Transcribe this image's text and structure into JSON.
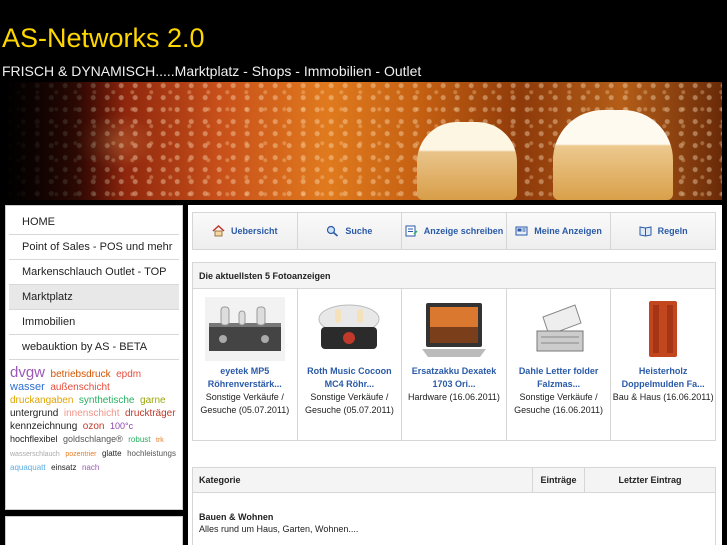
{
  "header": {
    "title": "AS-Networks 2.0",
    "subtitle": "FRISCH & DYNAMISCH.....Marktplatz - Shops - Immobilien - Outlet"
  },
  "sidebar": {
    "items": [
      {
        "label": "HOME"
      },
      {
        "label": "Point of Sales - POS und mehr"
      },
      {
        "label": "Markenschlauch Outlet - TOP"
      },
      {
        "label": "Marktplatz"
      },
      {
        "label": "Immobilien"
      },
      {
        "label": "webauktion by AS - BETA"
      }
    ],
    "tags": [
      {
        "text": "dvgw",
        "color": "#9b59b6",
        "size": "15px"
      },
      {
        "text": "betriebsdruck",
        "color": "#d35400",
        "size": "10px"
      },
      {
        "text": "epdm",
        "color": "#e74c3c",
        "size": "10px"
      },
      {
        "text": "wasser",
        "color": "#2e6fd1",
        "size": "11px"
      },
      {
        "text": "außenschicht",
        "color": "#e74c3c",
        "size": "10px"
      },
      {
        "text": "druckangaben",
        "color": "#e0a400",
        "size": "10px"
      },
      {
        "text": "synthetische",
        "color": "#27ae60",
        "size": "10px"
      },
      {
        "text": "garne",
        "color": "#9aa80c",
        "size": "10px"
      },
      {
        "text": "untergrund",
        "color": "#222222",
        "size": "10px"
      },
      {
        "text": "innenschicht",
        "color": "#f1948a",
        "size": "10px"
      },
      {
        "text": "druckträger",
        "color": "#c0392b",
        "size": "10px"
      },
      {
        "text": "kennzeichnung",
        "color": "#222222",
        "size": "10px"
      },
      {
        "text": "ozon",
        "color": "#c0392b",
        "size": "10px"
      },
      {
        "text": "100°c",
        "color": "#8e44ad",
        "size": "9px"
      },
      {
        "text": "hochflexibel",
        "color": "#222222",
        "size": "9px"
      },
      {
        "text": "goldschlange®",
        "color": "#555555",
        "size": "9px"
      },
      {
        "text": "robust",
        "color": "#27ae60",
        "size": "8px"
      },
      {
        "text": "trk",
        "color": "#e67e22",
        "size": "7px"
      },
      {
        "text": "wasserschlauch",
        "color": "#aaaaaa",
        "size": "7px"
      },
      {
        "text": "pozentrier",
        "color": "#e67e22",
        "size": "7px"
      },
      {
        "text": "glatte",
        "color": "#222222",
        "size": "8px"
      },
      {
        "text": "hochleistungs",
        "color": "#555555",
        "size": "8px"
      },
      {
        "text": "aquaquatt",
        "color": "#5dade2",
        "size": "8px"
      },
      {
        "text": "einsatz",
        "color": "#222222",
        "size": "8px"
      },
      {
        "text": "nach",
        "color": "#9b59b6",
        "size": "8px"
      }
    ]
  },
  "menu": [
    {
      "label": "Uebersicht",
      "icon": "home-icon"
    },
    {
      "label": "Suche",
      "icon": "search-icon"
    },
    {
      "label": "Anzeige schreiben",
      "icon": "write-ad-icon"
    },
    {
      "label": "Meine Anzeigen",
      "icon": "my-ads-icon"
    },
    {
      "label": "Regeln",
      "icon": "book-icon"
    }
  ],
  "photo_ads": {
    "title": "Die aktuellsten 5 Fotoanzeigen",
    "items": [
      {
        "title": "eyetek MP5 Röhrenverstärk...",
        "meta": "Sonstige Verkäufe / Gesuche (05.07.2011)"
      },
      {
        "title": "Roth Music Cocoon MC4 Röhr...",
        "meta": "Sonstige Verkäufe / Gesuche (05.07.2011)"
      },
      {
        "title": "Ersatzakku Dexatek 1703 Ori...",
        "meta": "Hardware (16.06.2011)"
      },
      {
        "title": "Dahle Letter folder Falzmas...",
        "meta": "Sonstige Verkäufe / Gesuche (16.06.2011)"
      },
      {
        "title": "Heisterholz Doppelmulden Fa...",
        "meta": "Bau & Haus (16.06.2011)"
      }
    ]
  },
  "categories": {
    "headers": {
      "category": "Kategorie",
      "entries": "Einträge",
      "last": "Letzter Eintrag"
    },
    "rows": [
      {
        "name": "Bauen & Wohnen",
        "description": "Alles rund um Haus, Garten, Wohnen...."
      }
    ]
  }
}
